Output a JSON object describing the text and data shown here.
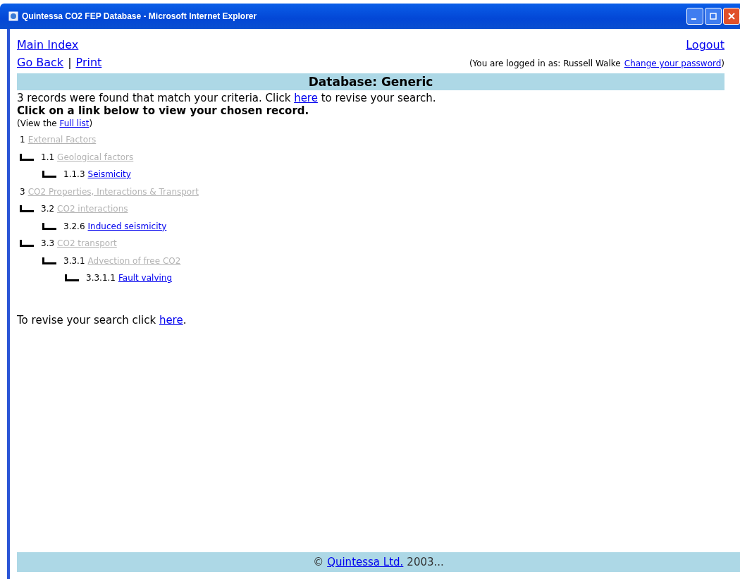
{
  "window": {
    "title": "Quintessa CO2 FEP Database - Microsoft Internet Explorer"
  },
  "nav": {
    "main_index": "Main Index",
    "logout": "Logout",
    "go_back": "Go Back",
    "separator": "|",
    "print": "Print"
  },
  "login": {
    "before": "(You are logged in as: Russell Walke",
    "link": "Change your password",
    "after": ")"
  },
  "header": "Database: Generic",
  "summary": {
    "before": "3 records were found that match your criteria. Click",
    "link": "here",
    "after": "to revise your search."
  },
  "instruction": "Click on a link below to view your chosen record.",
  "full_list": {
    "before": "(View the",
    "link": "Full list",
    "after": ")"
  },
  "tree": [
    {
      "number": "1",
      "label": "External Factors",
      "match": false,
      "children": [
        {
          "number": "1.1",
          "label": "Geological factors",
          "match": false,
          "children": [
            {
              "number": "1.1.3",
              "label": "Seismicity",
              "match": true
            }
          ]
        }
      ]
    },
    {
      "number": "3",
      "label": "CO2 Properties, Interactions & Transport",
      "match": false,
      "children": [
        {
          "number": "3.2",
          "label": "CO2 interactions",
          "match": false,
          "children": [
            {
              "number": "3.2.6",
              "label": "Induced seismicity",
              "match": true
            }
          ]
        },
        {
          "number": "3.3",
          "label": "CO2 transport",
          "match": false,
          "children": [
            {
              "number": "3.3.1",
              "label": "Advection of free CO2",
              "match": false,
              "children": [
                {
                  "number": "3.3.1.1",
                  "label": "Fault valving",
                  "match": true
                }
              ]
            }
          ]
        }
      ]
    }
  ],
  "revise": {
    "before": "To revise your search click",
    "link": "here",
    "after": "."
  },
  "footer": {
    "symbol": "©",
    "link": "Quintessa Ltd.",
    "after": "2003..."
  }
}
